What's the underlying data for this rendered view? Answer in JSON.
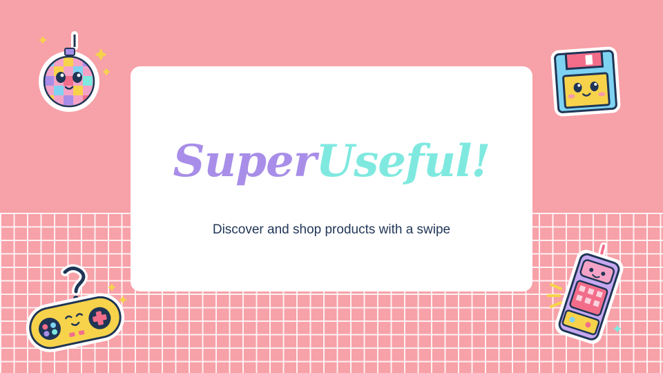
{
  "slide": {
    "title_part1": "Super",
    "title_part2": "Useful!",
    "subtitle": "Discover and shop products with a swipe"
  },
  "colors": {
    "background": "#f7a1a8",
    "grid_lines": "#ffffff",
    "card": "#ffffff",
    "title_purple": "#a88ee8",
    "title_teal": "#7fe9e0",
    "subtitle": "#1f3556"
  },
  "stickers": [
    "disco-ball-icon",
    "floppy-disk-icon",
    "game-controller-icon",
    "arcade-machine-icon"
  ]
}
